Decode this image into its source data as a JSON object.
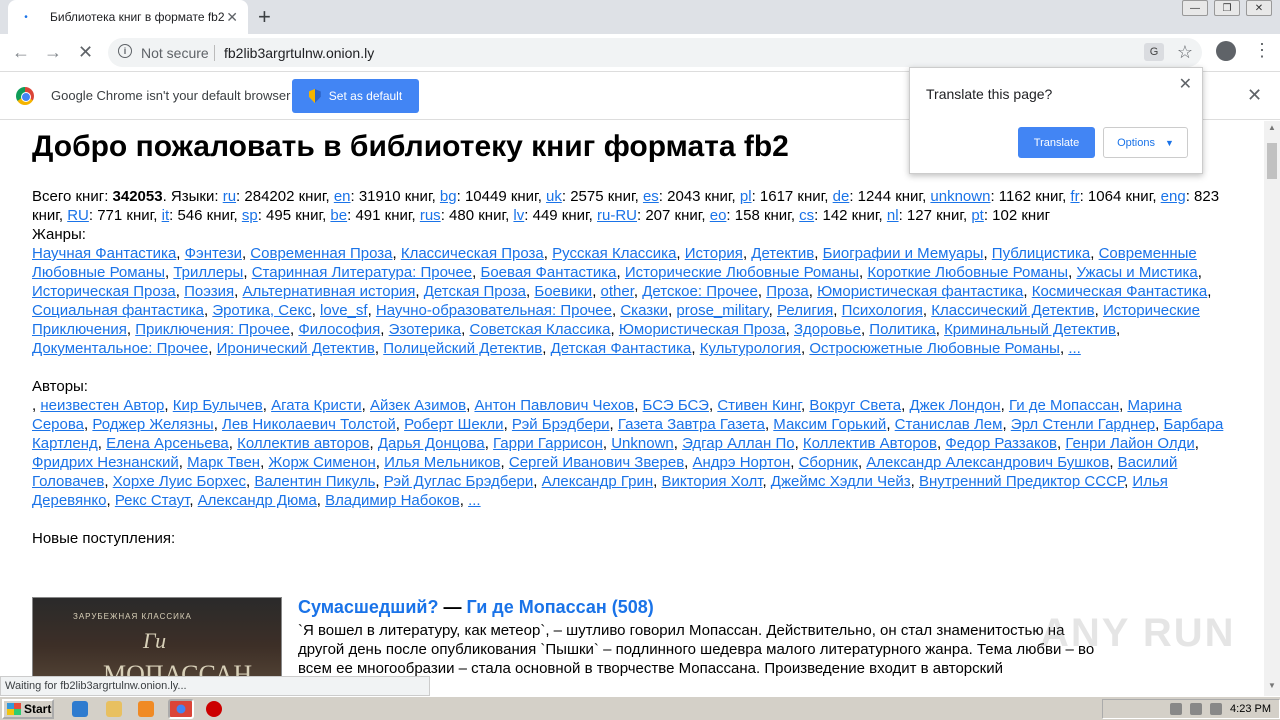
{
  "browser": {
    "tab_title": "Библиотека книг в формате fb2",
    "url": "fb2lib3argrtulnw.onion.ly",
    "security_label": "Not secure",
    "default_msg": "Google Chrome isn't your default browser",
    "set_default_label": "Set as default",
    "status_text": "Waiting for fb2lib3argrtulnw.onion.ly...",
    "accent_color": "#4285f4"
  },
  "translate": {
    "question": "Translate this page?",
    "translate_label": "Translate",
    "options_label": "Options"
  },
  "page": {
    "heading": "Добро пожаловать в библиотеку книг формата fb2",
    "total_label": "Всего книг:",
    "total_count": "342053",
    "languages_label": "Языки:",
    "languages": [
      {
        "code": "ru",
        "count": "284202 книг"
      },
      {
        "code": "en",
        "count": "31910 книг"
      },
      {
        "code": "bg",
        "count": "10449 книг"
      },
      {
        "code": "uk",
        "count": "2575 книг"
      },
      {
        "code": "es",
        "count": "2043 книг"
      },
      {
        "code": "pl",
        "count": "1617 книг"
      },
      {
        "code": "de",
        "count": "1244 книг"
      },
      {
        "code": "unknown",
        "count": "1162 книг"
      },
      {
        "code": "fr",
        "count": "1064 книг"
      },
      {
        "code": "eng",
        "count": "823 книг"
      },
      {
        "code": "RU",
        "count": "771 книг"
      },
      {
        "code": "it",
        "count": "546 книг"
      },
      {
        "code": "sp",
        "count": "495 книг"
      },
      {
        "code": "be",
        "count": "491 книг"
      },
      {
        "code": "rus",
        "count": "480 книг"
      },
      {
        "code": "lv",
        "count": "449 книг"
      },
      {
        "code": "ru-RU",
        "count": "207 книг"
      },
      {
        "code": "eo",
        "count": "158 книг"
      },
      {
        "code": "cs",
        "count": "142 книг"
      },
      {
        "code": "nl",
        "count": "127 книг"
      },
      {
        "code": "pt",
        "count": "102 книг"
      }
    ],
    "genres_label": "Жанры:",
    "genres": [
      "Научная Фантастика",
      "Фэнтези",
      "Современная Проза",
      "Классическая Проза",
      "Русская Классика",
      "История",
      "Детектив",
      "Биографии и Мемуары",
      "Публицистика",
      "Современные Любовные Романы",
      "Триллеры",
      "Старинная Литература: Прочее",
      "Боевая Фантастика",
      "Исторические Любовные Романы",
      "Короткие Любовные Романы",
      "Ужасы и Мистика",
      "Историческая Проза",
      "Поэзия",
      "Альтернативная история",
      "Детская Проза",
      "Боевики",
      "other",
      "Детское: Прочее",
      "Проза",
      "Юмористическая фантастика",
      "Космическая Фантастика",
      "Социальная фантастика",
      "Эротика, Секс",
      "love_sf",
      "Научно-образовательная: Прочее",
      "Сказки",
      "prose_military",
      "Религия",
      "Психология",
      "Классический Детектив",
      "Исторические Приключения",
      "Приключения: Прочее",
      "Философия",
      "Эзотерика",
      "Советская Классика",
      "Юмористическая Проза",
      "Здоровье",
      "Политика",
      "Криминальный Детектив",
      "Документальное: Прочее",
      "Иронический Детектив",
      "Полицейский Детектив",
      "Детская Фантастика",
      "Культурология",
      "Остросюжетные Любовные Романы",
      "..."
    ],
    "authors_label": "Авторы:",
    "authors": [
      "неизвестен Автор",
      "Кир Булычев",
      "Агата Кристи",
      "Айзек Азимов",
      "Антон Павлович Чехов",
      "БСЭ БСЭ",
      "Стивен Кинг",
      "Вокруг Света",
      "Джек Лондон",
      "Ги де Мопассан",
      "Марина Серова",
      "Роджер Желязны",
      "Лев Николаевич Толстой",
      "Роберт Шекли",
      "Рэй Брэдбери",
      "Газета Завтра Газета",
      "Максим Горький",
      "Станислав Лем",
      "Эрл Стенли Гарднер",
      "Барбара Картленд",
      "Елена Арсеньева",
      "Коллектив авторов",
      "Дарья Донцова",
      "Гарри Гаррисон",
      "Unknown",
      "Эдгар Аллан По",
      "Коллектив Авторов",
      "Федор Раззаков",
      "Генри Лайон Олди",
      "Фридрих Незнанский",
      "Марк Твен",
      "Жорж Сименон",
      "Илья Мельников",
      "Сергей Иванович Зверев",
      "Андрэ Нортон",
      "Сборник",
      "Александр Александрович Бушков",
      "Василий Головачев",
      "Хорхе Луис Борхес",
      "Валентин Пикуль",
      "Рэй Дуглас Брэдбери",
      "Александр Грин",
      "Виктория Холт",
      "Джеймс Хэдли Чейз",
      "Внутренний Предиктор СССР",
      "Илья Деревянко",
      "Рекс Стаут",
      "Александр Дюма",
      "Владимир Набоков",
      "..."
    ],
    "new_label": "Новые поступления:",
    "book": {
      "title": "Сумасшедший?",
      "dash": "—",
      "author": "Ги де Мопассан (508)",
      "desc": "`Я вошел в литературу, как метеор`, – шутливо говорил Мопассан. Действительно, он стал знаменитостью на другой день после опубликования `Пышки` – подлинного шедевра малого литературного жанра. Тема любви – во всем ее многообразии – стала основной в творчестве Мопассана.  Произведение входит в авторский",
      "cover_series": "ЗАРУБЕЖНАЯ КЛАССИКА",
      "cover_name": "Ги",
      "cover_surname": "МОПАССАН"
    }
  },
  "watermark": "ANY RUN",
  "taskbar": {
    "start_label": "Start",
    "time": "4:23 PM"
  }
}
